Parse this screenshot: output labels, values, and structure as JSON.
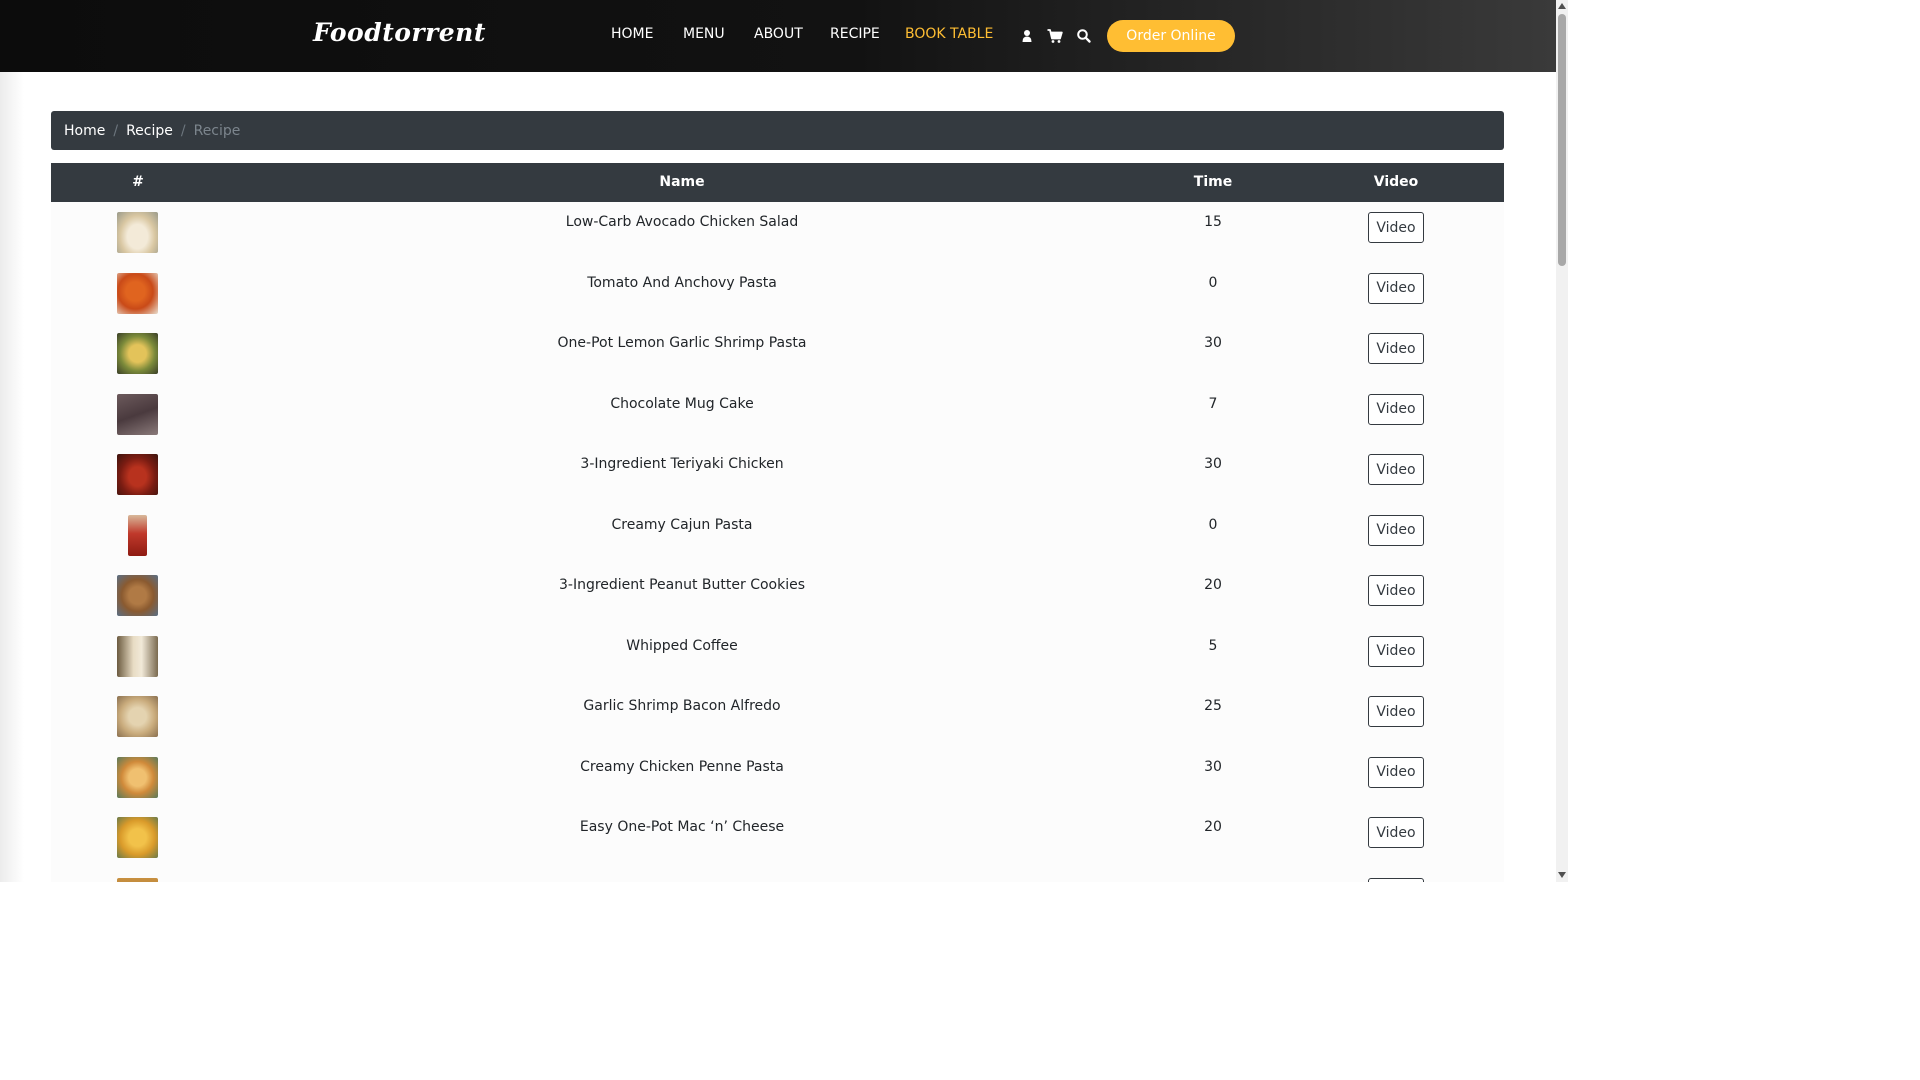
{
  "header": {
    "brand": "Foodtorrent",
    "nav": [
      "HOME",
      "MENU",
      "ABOUT",
      "RECIPE",
      "BOOK TABLE"
    ],
    "active_nav": "BOOK TABLE",
    "order_label": "Order Online",
    "icons": [
      "user-icon",
      "cart-icon",
      "search-icon"
    ]
  },
  "breadcrumb": [
    "Home",
    "Recipe",
    "Recipe"
  ],
  "table": {
    "headers": [
      "#",
      "Name",
      "Time",
      "Video"
    ],
    "video_label": "Video",
    "rows": [
      {
        "name": "Low-Carb Avocado Chicken Salad",
        "time": "15"
      },
      {
        "name": "Tomato And Anchovy Pasta",
        "time": "0"
      },
      {
        "name": "One-Pot Lemon Garlic Shrimp Pasta",
        "time": "30"
      },
      {
        "name": "Chocolate Mug Cake",
        "time": "7"
      },
      {
        "name": "3-Ingredient Teriyaki Chicken",
        "time": "30"
      },
      {
        "name": "Creamy Cajun Pasta",
        "time": "0"
      },
      {
        "name": "3-Ingredient Peanut Butter Cookies",
        "time": "20"
      },
      {
        "name": "Whipped Coffee",
        "time": "5"
      },
      {
        "name": "Garlic Shrimp Bacon Alfredo",
        "time": "25"
      },
      {
        "name": "Creamy Chicken Penne Pasta",
        "time": "30"
      },
      {
        "name": "Easy One-Pot Mac ‘n’ Cheese",
        "time": "20"
      },
      {
        "name": "",
        "time": ""
      }
    ]
  },
  "colors": {
    "accent": "#ffbe33",
    "dark_bar": "#343a40"
  }
}
